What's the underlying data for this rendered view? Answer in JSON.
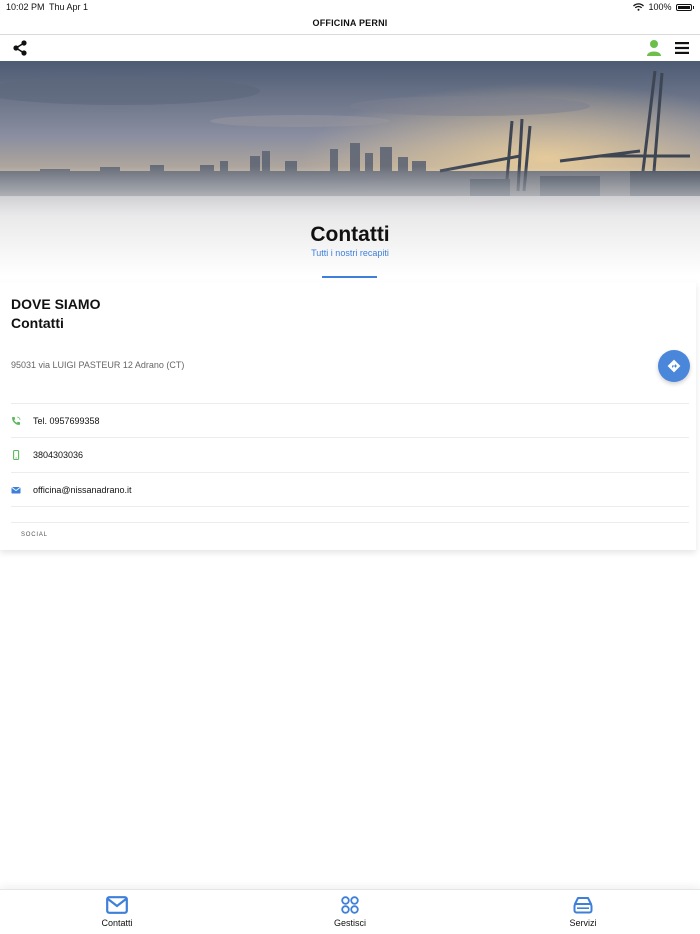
{
  "status_bar": {
    "time": "10:02 PM",
    "date": "Thu Apr 1",
    "battery": "100%"
  },
  "app": {
    "title": "OFFICINA PERNI"
  },
  "hero": {
    "title": "Contatti",
    "subtitle": "Tutti i nostri recapiti"
  },
  "location": {
    "heading": "DOVE SIAMO",
    "subheading": "Contatti",
    "address": "95031 via LUIGI PASTEUR 12 Adrano (CT)"
  },
  "contacts": [
    {
      "icon": "phone-icon",
      "value": "Tel. 0957699358",
      "color": "#5cb85c"
    },
    {
      "icon": "mobile-icon",
      "value": "3804303036",
      "color": "#5cb85c"
    },
    {
      "icon": "envelope-icon",
      "value": "officina@nissanadrano.it",
      "color": "#3d7fd9"
    }
  ],
  "social": {
    "label": "SOCIAL"
  },
  "tabs": [
    {
      "label": "Contatti",
      "icon": "envelope-icon"
    },
    {
      "label": "Gestisci",
      "icon": "grid-icon"
    },
    {
      "label": "Servizi",
      "icon": "stack-icon"
    }
  ],
  "colors": {
    "accent": "#3d7fd9",
    "user_icon": "#6cbf4a",
    "fab": "#4a87da"
  }
}
